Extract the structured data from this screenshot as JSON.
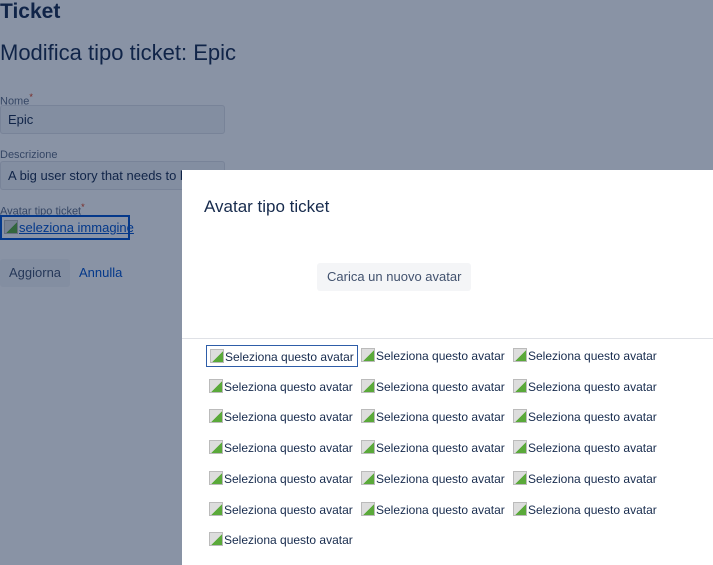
{
  "page": {
    "section": "Ticket",
    "title": "Modifica tipo ticket: Epic",
    "name_label": "Nome",
    "name_value": "Epic",
    "desc_label": "Descrizione",
    "desc_value": "A big user story that needs to be broken down.",
    "avatar_label": "Avatar tipo ticket",
    "avatar_link": "seleziona immagine",
    "update_button": "Aggiorna",
    "cancel_button": "Annulla",
    "required_mark": "*"
  },
  "dialog": {
    "title": "Avatar tipo ticket",
    "upload_button": "Carica un nuovo avatar",
    "avatars": [
      "Seleziona questo avatar",
      "Seleziona questo avatar",
      "Seleziona questo avatar",
      "Seleziona questo avatar",
      "Seleziona questo avatar",
      "Seleziona questo avatar",
      "Seleziona questo avatar",
      "Seleziona questo avatar",
      "Seleziona questo avatar",
      "Seleziona questo avatar",
      "Seleziona questo avatar",
      "Seleziona questo avatar",
      "Seleziona questo avatar",
      "Seleziona questo avatar",
      "Seleziona questo avatar",
      "Seleziona questo avatar",
      "Seleziona questo avatar",
      "Seleziona questo avatar",
      "Seleziona questo avatar"
    ],
    "selected_index": 0
  },
  "colors": {
    "overlay": "#091e42",
    "link": "#0052cc",
    "required": "#de350b"
  }
}
